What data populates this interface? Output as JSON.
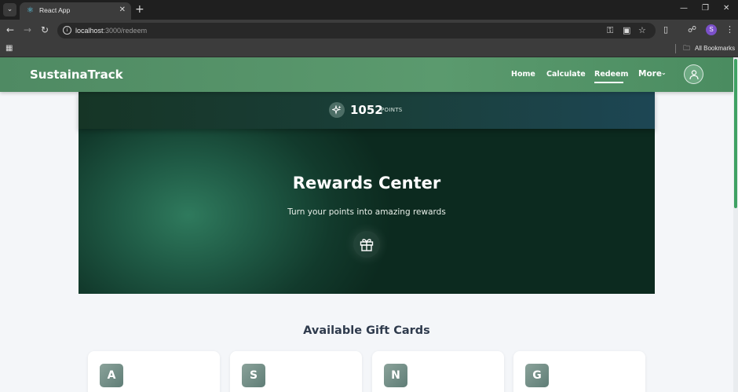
{
  "browser": {
    "tab_title": "React App",
    "url_host": "localhost",
    "url_path": ":3000/redeem",
    "bookmarks_label": "All Bookmarks",
    "profile_initial": "S"
  },
  "navbar": {
    "brand": "SustainaTrack",
    "links": [
      "Home",
      "Calculate",
      "Redeem",
      "More"
    ],
    "active_link": "Redeem"
  },
  "points": {
    "value": "1052",
    "label": "POINTS"
  },
  "hero": {
    "title": "Rewards Center",
    "subtitle": "Turn your points into amazing rewards",
    "icon": "gift-icon"
  },
  "gift_cards": {
    "heading": "Available Gift Cards",
    "cards": [
      {
        "initial": "A"
      },
      {
        "initial": "S"
      },
      {
        "initial": "N"
      },
      {
        "initial": "G"
      }
    ]
  },
  "colors": {
    "navbar_green": "#5b9a6e",
    "hero_dark": "#0c2a1f",
    "heading_text": "#2f3b4d",
    "badge": "#6f8c85"
  }
}
